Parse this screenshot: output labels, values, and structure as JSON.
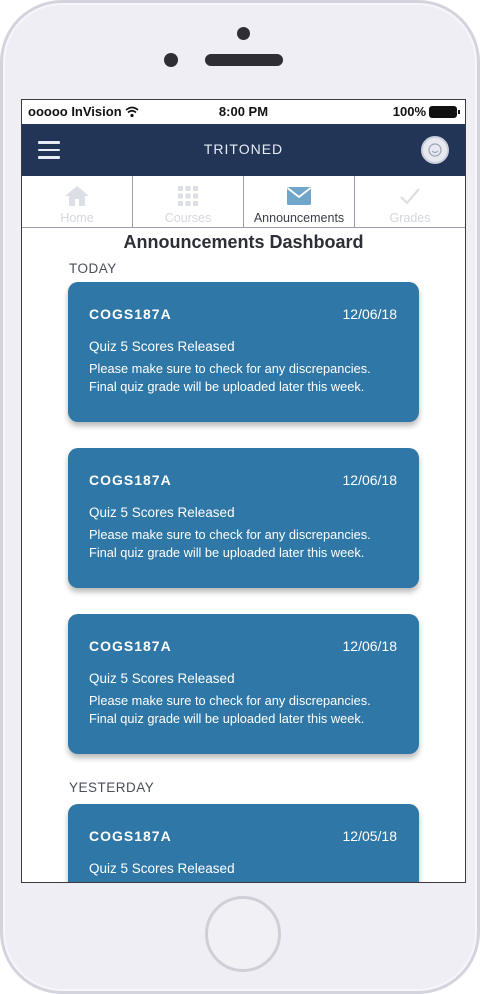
{
  "status_bar": {
    "carrier": "ooooo InVision",
    "time": "8:00 PM",
    "battery": "100%"
  },
  "header": {
    "title": "TRITONED"
  },
  "tabs": [
    {
      "label": "Home",
      "icon": "home-icon",
      "active": false
    },
    {
      "label": "Courses",
      "icon": "grid-icon",
      "active": false
    },
    {
      "label": "Announcements",
      "icon": "envelope-icon",
      "active": true
    },
    {
      "label": "Grades",
      "icon": "checkmark-icon",
      "active": false
    }
  ],
  "page_title": "Announcements Dashboard",
  "sections": {
    "today": "TODAY",
    "yesterday": "YESTERDAY"
  },
  "announcements": [
    {
      "course": "COGS187A",
      "date": "12/06/18",
      "title": "Quiz 5 Scores Released",
      "body": "Please make sure to check for any discrepancies. Final quiz grade will be uploaded later this week."
    },
    {
      "course": "COGS187A",
      "date": "12/06/18",
      "title": "Quiz 5 Scores Released",
      "body": "Please make sure to check for any discrepancies. Final quiz grade will be uploaded later this week."
    },
    {
      "course": "COGS187A",
      "date": "12/06/18",
      "title": "Quiz 5 Scores Released",
      "body": "Please make sure to check for any discrepancies. Final quiz grade will be uploaded later this week."
    },
    {
      "course": "COGS187A",
      "date": "12/05/18",
      "title": "Quiz 5 Scores Released",
      "body": ""
    }
  ],
  "colors": {
    "header": "#223557",
    "card": "#2f77a6",
    "tab_inactive": "#d4d7de"
  }
}
